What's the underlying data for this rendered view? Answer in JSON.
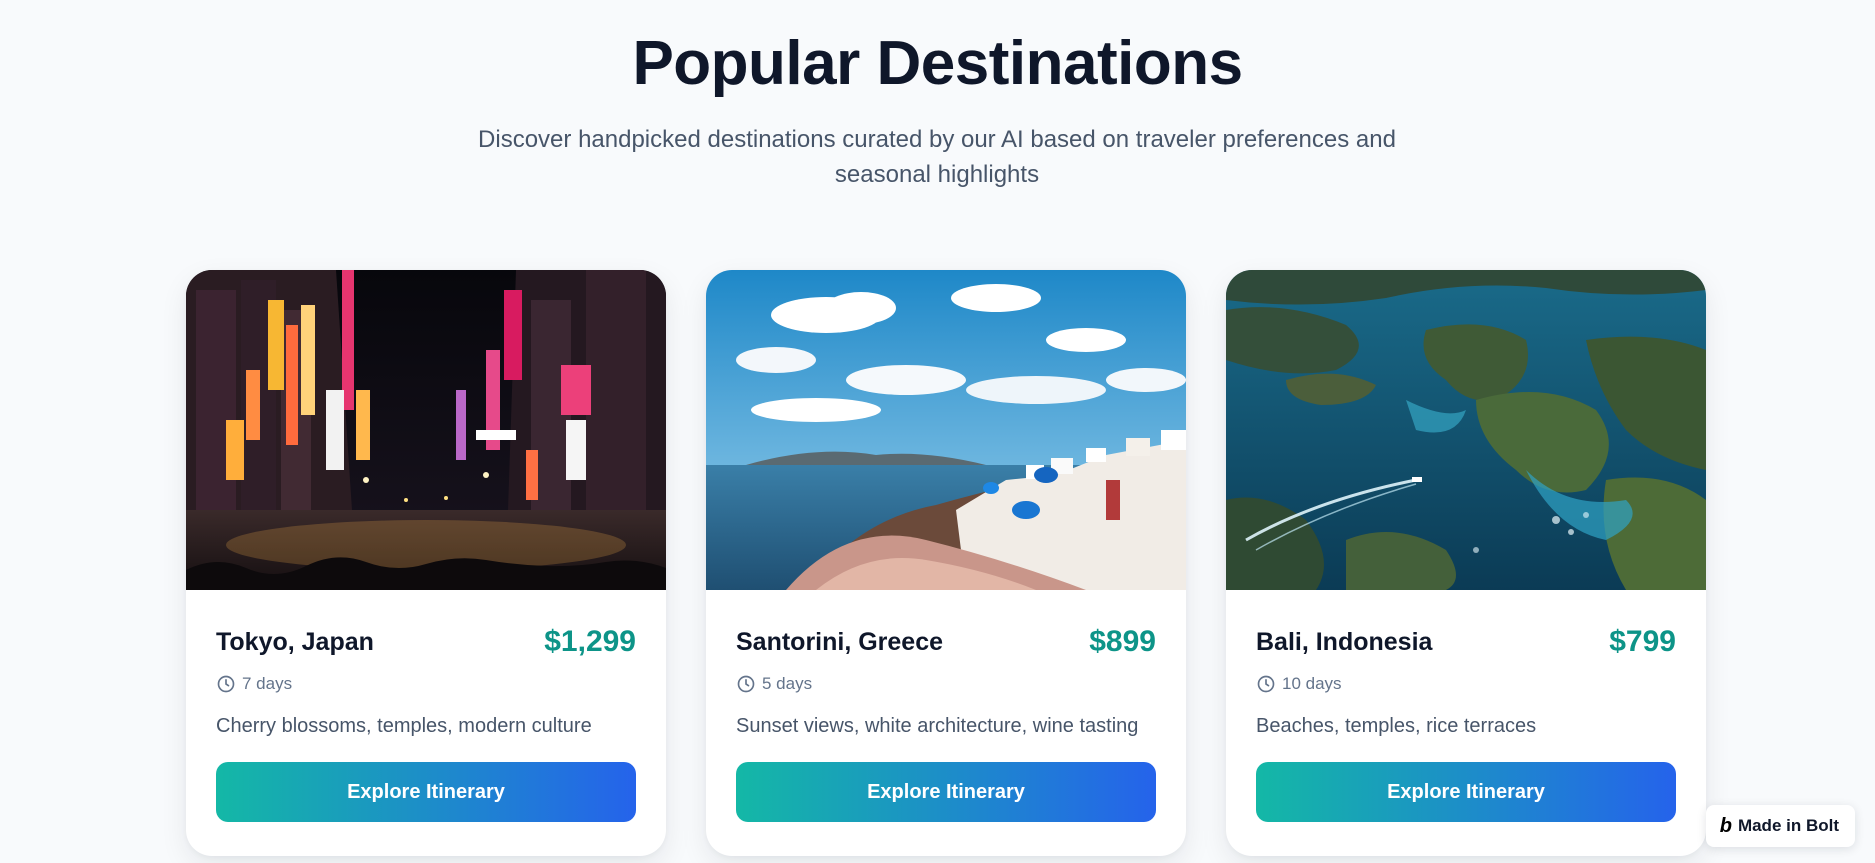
{
  "header": {
    "title": "Popular Destinations",
    "subtitle": "Discover handpicked destinations curated by our AI based on traveler preferences and seasonal highlights"
  },
  "destinations": [
    {
      "name": "Tokyo, Japan",
      "price": "$1,299",
      "duration": "7 days",
      "description": "Cherry blossoms, temples, modern culture",
      "button_label": "Explore Itinerary",
      "image": "tokyo-night-street-photo"
    },
    {
      "name": "Santorini, Greece",
      "price": "$899",
      "duration": "5 days",
      "description": "Sunset views, white architecture, wine tasting",
      "button_label": "Explore Itinerary",
      "image": "santorini-coast-photo"
    },
    {
      "name": "Bali, Indonesia",
      "price": "$799",
      "duration": "10 days",
      "description": "Beaches, temples, rice terraces",
      "button_label": "Explore Itinerary",
      "image": "tropical-islands-aerial-photo"
    }
  ],
  "badge": {
    "logo": "b",
    "label": "Made in Bolt"
  },
  "colors": {
    "background": "#f8fafc",
    "heading": "#0f172a",
    "price": "#0d9488",
    "button_gradient_start": "#14b8a6",
    "button_gradient_end": "#2563eb"
  },
  "icons": {
    "duration": "clock-icon"
  }
}
